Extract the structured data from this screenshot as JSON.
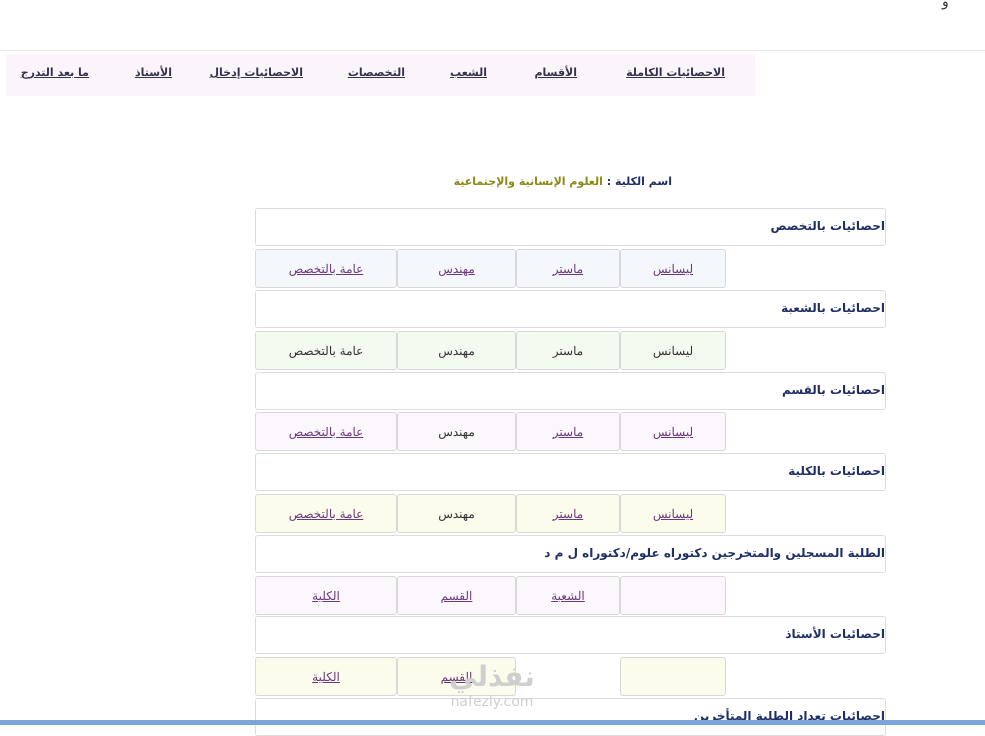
{
  "top_mark": "و",
  "nav": {
    "items": [
      {
        "label": "الاحصائيات الكاملة"
      },
      {
        "label": "الأقسام"
      },
      {
        "label": "الشعب"
      },
      {
        "label": "التخصصات"
      },
      {
        "label": "الاحصائيات إدخال"
      },
      {
        "label": "الأستاذ"
      },
      {
        "label": "ما بعد التدرج"
      }
    ]
  },
  "college": {
    "label": "اسم الكلية :",
    "name": "العلوم الإنسانية والإجتماعية"
  },
  "sections": [
    {
      "title": "احصائيات بالتخصص",
      "cells": [
        "ليسانس",
        "ماستر",
        "مهندس",
        "عامة بالتخصص"
      ]
    },
    {
      "title": "احصائيات بالشعبة",
      "cells": [
        "ليسانس",
        "ماستر",
        "مهندس",
        "عامة بالتخصص"
      ]
    },
    {
      "title": "احصائيات بالقسم",
      "cells": [
        "ليسانس",
        "ماستر",
        "مهندس",
        "عامة بالتخصص"
      ]
    },
    {
      "title": "احصائيات بالكلية",
      "cells": [
        "ليسانس",
        "ماستر",
        "مهندس",
        "عامة بالتخصص"
      ]
    },
    {
      "title": "الطلبة المسجلين والمتخرجين دكتوراه علوم/دكتوراه ل م د",
      "cells": [
        "",
        "الشعبة",
        "القسم",
        "الكلية"
      ]
    },
    {
      "title": "احصائيات الأستاذ",
      "cells": [
        "",
        "",
        "القسم",
        "الكلية"
      ]
    },
    {
      "title": "احصائيات تعداد الطلبة المتأخرين"
    }
  ],
  "watermark": {
    "brand": "نفذلي",
    "domain": "nafezly.com"
  }
}
